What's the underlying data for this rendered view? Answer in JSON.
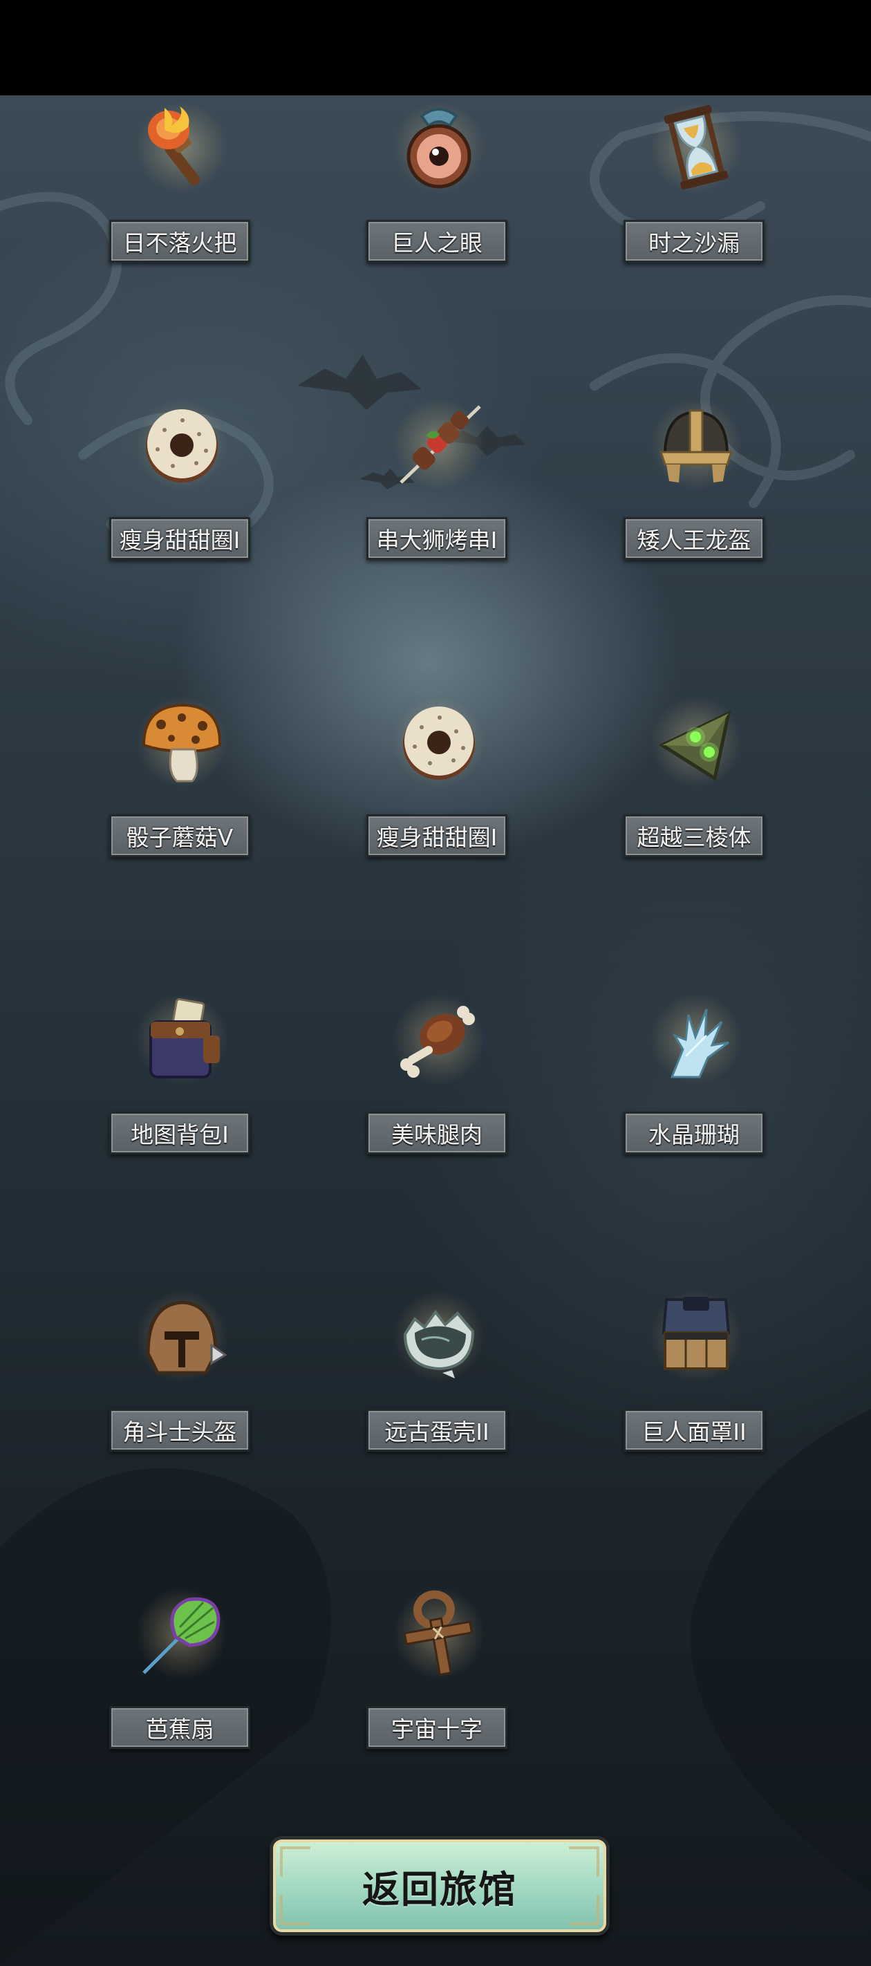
{
  "items": [
    {
      "name": "日不落火把",
      "icon": "torch-icon"
    },
    {
      "name": "巨人之眼",
      "icon": "giant-eye-icon"
    },
    {
      "name": "时之沙漏",
      "icon": "hourglass-icon"
    },
    {
      "name": "瘦身甜甜圈I",
      "icon": "donut-icon"
    },
    {
      "name": "串大狮烤串I",
      "icon": "skewer-icon"
    },
    {
      "name": "矮人王龙盔",
      "icon": "dwarf-helmet-icon"
    },
    {
      "name": "骰子蘑菇V",
      "icon": "mushroom-icon"
    },
    {
      "name": "瘦身甜甜圈I",
      "icon": "donut-icon"
    },
    {
      "name": "超越三棱体",
      "icon": "prism-icon"
    },
    {
      "name": "地图背包I",
      "icon": "map-backpack-icon"
    },
    {
      "name": "美味腿肉",
      "icon": "drumstick-icon"
    },
    {
      "name": "水晶珊瑚",
      "icon": "crystal-coral-icon"
    },
    {
      "name": "角斗士头盔",
      "icon": "gladiator-helmet-icon"
    },
    {
      "name": "远古蛋壳II",
      "icon": "eggshell-icon"
    },
    {
      "name": "巨人面罩II",
      "icon": "giant-mask-icon"
    },
    {
      "name": "芭蕉扇",
      "icon": "banana-fan-icon"
    },
    {
      "name": "宇宙十字",
      "icon": "cosmic-cross-icon"
    }
  ],
  "return_button": {
    "label": "返回旅馆"
  },
  "colors": {
    "label_bg": "#5f676c",
    "button_bg": "#a8dcc4",
    "background": "#2f3d47"
  }
}
